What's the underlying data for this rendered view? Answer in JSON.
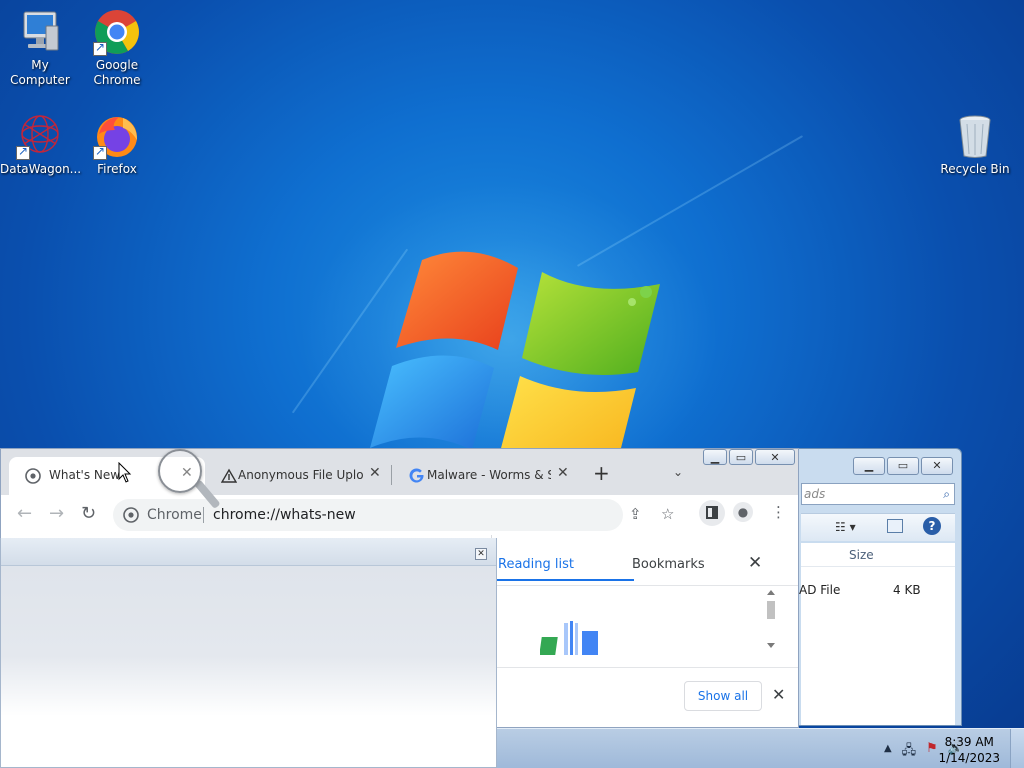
{
  "desktop": {
    "icons": [
      {
        "label": "My Computer"
      },
      {
        "label": "Google Chrome"
      },
      {
        "label": "DataWagon..."
      },
      {
        "label": "Firefox"
      },
      {
        "label": "Recycle Bin"
      }
    ]
  },
  "chrome": {
    "tabs": [
      {
        "title": "What's New"
      },
      {
        "title": "Anonymous File Upload"
      },
      {
        "title": "Malware - Worms & Sta"
      }
    ],
    "new_tab_icon": "+",
    "tab_list_icon": "⌄",
    "omnibox": {
      "scheme_label": "Chrome",
      "url": "chrome://whats-new"
    },
    "side_panel": {
      "tabs": [
        "Reading list",
        "Bookmarks"
      ],
      "show_all_label": "Show all"
    }
  },
  "explorer": {
    "search_placeholder": "ads",
    "column_header": "Size",
    "row": {
      "type": "AD File",
      "size": "4 KB"
    }
  },
  "taskbar": {
    "time": "8:39 AM",
    "date": "1/14/2023"
  },
  "colors": {
    "accent": "#1a73e8",
    "desktop_blue": "#0a4fae"
  }
}
